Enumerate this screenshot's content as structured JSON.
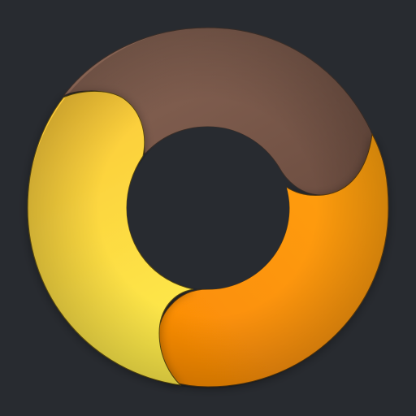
{
  "colors": {
    "background": "#282b30",
    "brown": "#7d5b4b",
    "orange": "#ff9a0a",
    "yellow": "#fdd23a",
    "hole": "#282b30"
  },
  "icon": {
    "name": "app-icon",
    "segments": [
      {
        "name": "brown-segment"
      },
      {
        "name": "orange-segment"
      },
      {
        "name": "yellow-segment"
      }
    ]
  }
}
